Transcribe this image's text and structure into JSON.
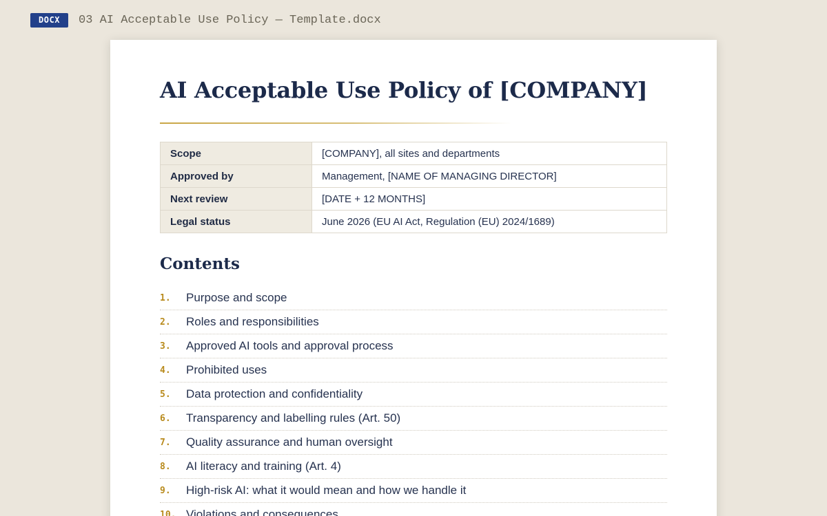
{
  "file": {
    "badge": "DOCX",
    "name": "03 AI Acceptable Use Policy — Template.docx"
  },
  "document": {
    "title": "AI Acceptable Use Policy of [COMPANY]",
    "meta": [
      {
        "key": "Scope",
        "value": "[COMPANY], all sites and departments"
      },
      {
        "key": "Approved by",
        "value": "Management, [NAME OF MANAGING DIRECTOR]"
      },
      {
        "key": "Next review",
        "value": "[DATE + 12 MONTHS]"
      },
      {
        "key": "Legal status",
        "value": "June 2026 (EU AI Act, Regulation (EU) 2024/1689)"
      }
    ],
    "contents_heading": "Contents",
    "toc": [
      {
        "num": "1.",
        "label": "Purpose and scope"
      },
      {
        "num": "2.",
        "label": "Roles and responsibilities"
      },
      {
        "num": "3.",
        "label": "Approved AI tools and approval process"
      },
      {
        "num": "4.",
        "label": "Prohibited uses"
      },
      {
        "num": "5.",
        "label": "Data protection and confidentiality"
      },
      {
        "num": "6.",
        "label": "Transparency and labelling rules (Art. 50)"
      },
      {
        "num": "7.",
        "label": "Quality assurance and human oversight"
      },
      {
        "num": "8.",
        "label": "AI literacy and training (Art. 4)"
      },
      {
        "num": "9.",
        "label": "High-risk AI: what it would mean and how we handle it"
      },
      {
        "num": "10.",
        "label": "Violations and consequences"
      }
    ]
  },
  "colors": {
    "background": "#ebe6dc",
    "badge": "#22408a",
    "heading": "#1c2a4a",
    "accent_gold": "#c9a646",
    "table_key_bg": "#efebe1"
  }
}
